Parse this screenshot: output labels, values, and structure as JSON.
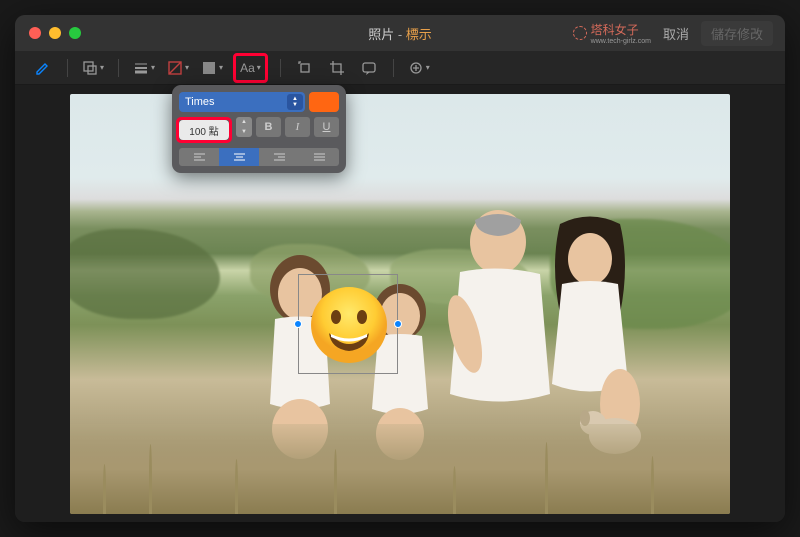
{
  "titlebar": {
    "file_name": "照片",
    "separator": " - ",
    "app_mode": "標示"
  },
  "watermark": {
    "text": "塔科女子",
    "sub": "www.tech-girlz.com"
  },
  "buttons": {
    "cancel": "取消",
    "done": "儲存修改"
  },
  "font_panel": {
    "font_name": "Times",
    "size_label": "100 點",
    "bold": "B",
    "italic": "I",
    "underline": "U"
  },
  "colors": {
    "accent": "#0a84ff",
    "highlight": "#ff0033",
    "swatch": "#ff6612"
  }
}
